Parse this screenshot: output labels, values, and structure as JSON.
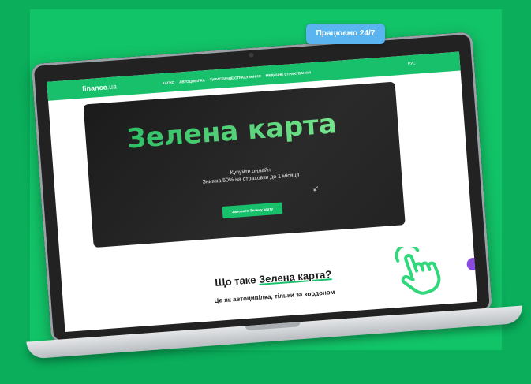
{
  "navbar": {
    "logo_main": "finance",
    "logo_tld": ".ua",
    "links": [
      "КАСКО",
      "АВТОЦИВІЛКА",
      "ТУРИСТИЧНЕ СТРАХУВАННЯ",
      "МЕДИЧНЕ СТРАХУВАННЯ"
    ],
    "lang": "РУС"
  },
  "badge": {
    "label": "Працюємо 24/7"
  },
  "hero": {
    "title": "Зелена карта",
    "subtitle_line1": "Купуйте онлайн",
    "subtitle_line2": "Знижка 50% на страховки до 1 місяця",
    "cta_label": "Замовити Зелену карту"
  },
  "section": {
    "title_prefix": "Що таке ",
    "title_highlight": "Зелена карта?",
    "subtitle": "Це як автоцивілка, тільки за кордоном"
  },
  "icons": {
    "pointer": "hand-pointer-icon",
    "chat": "chat-bubble-icon",
    "arrow": "curved-arrow-icon"
  },
  "colors": {
    "background": "#0aae5b",
    "brand_green": "#19c06b",
    "badge_blue": "#5ab4f0",
    "hero_dark": "#1b1b1b"
  }
}
